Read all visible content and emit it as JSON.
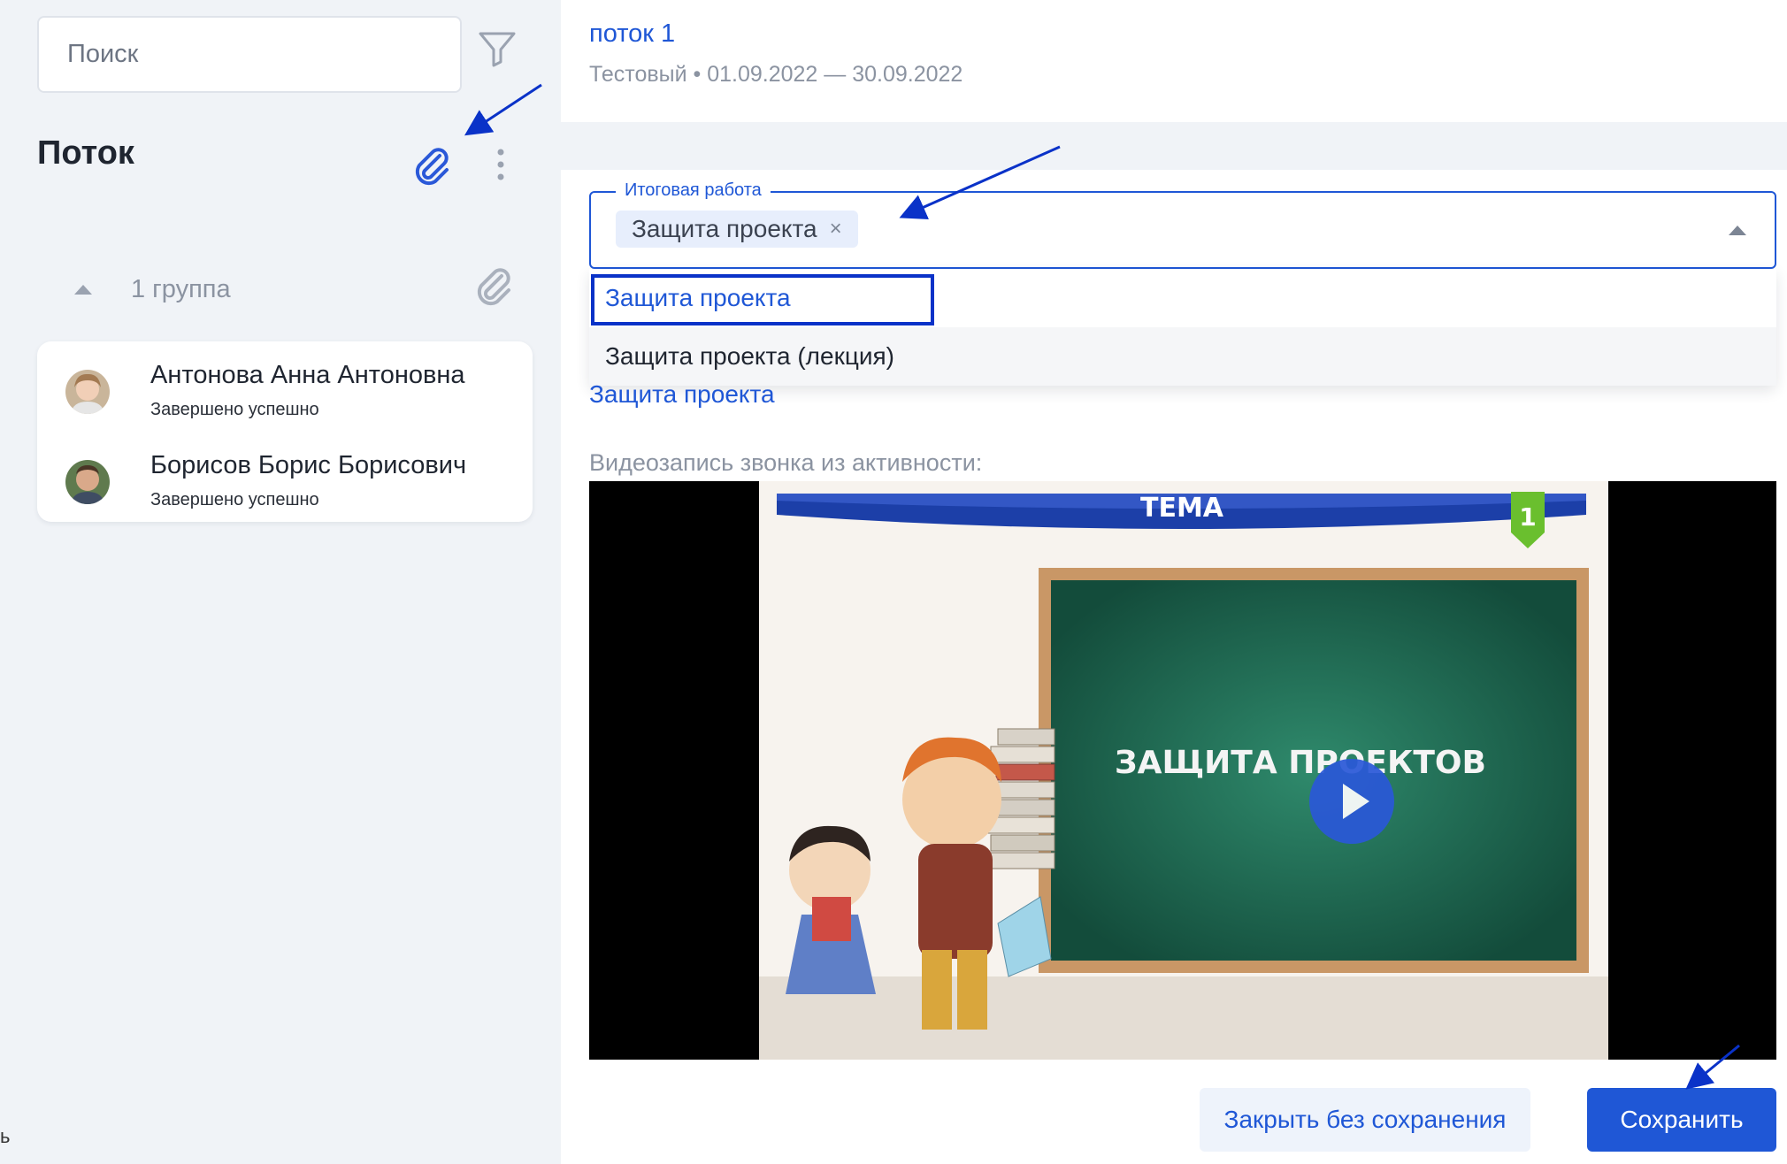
{
  "sidebar": {
    "search_placeholder": "Поиск",
    "title": "Поток",
    "group": {
      "label": "1 группа",
      "expanded": true
    },
    "students": [
      {
        "name": "Антонова Анна Антоновна",
        "status": "Завершено успешно"
      },
      {
        "name": "Борисов Борис Борисович",
        "status": "Завершено успешно"
      }
    ],
    "edge_text": "ь"
  },
  "header": {
    "title": "поток 1",
    "subtitle": "Тестовый • 01.09.2022 — 30.09.2022"
  },
  "final_work": {
    "label": "Итоговая работа",
    "selected": "Защита проекта",
    "remove_glyph": "×",
    "options": [
      "Защита проекта",
      "Защита проекта (лекция)"
    ],
    "highlighted_option_index": 1,
    "link_below": "Защита проекта"
  },
  "video": {
    "label": "Видеозапись звонка из активности:",
    "banner_text": "ТЕМА",
    "badge_number": "1",
    "board_text": "ЗАЩИТА ПРОЕКТОВ"
  },
  "footer": {
    "close_label": "Закрыть без сохранения",
    "save_label": "Сохранить"
  },
  "colors": {
    "accent": "#1f57d6",
    "annotation": "#0a32c8",
    "background": "#f0f3f7",
    "muted_text": "#8b93a1"
  },
  "icons": [
    "filter-icon",
    "paperclip-icon",
    "more-vertical-icon",
    "caret-up-icon",
    "close-icon",
    "play-icon"
  ]
}
